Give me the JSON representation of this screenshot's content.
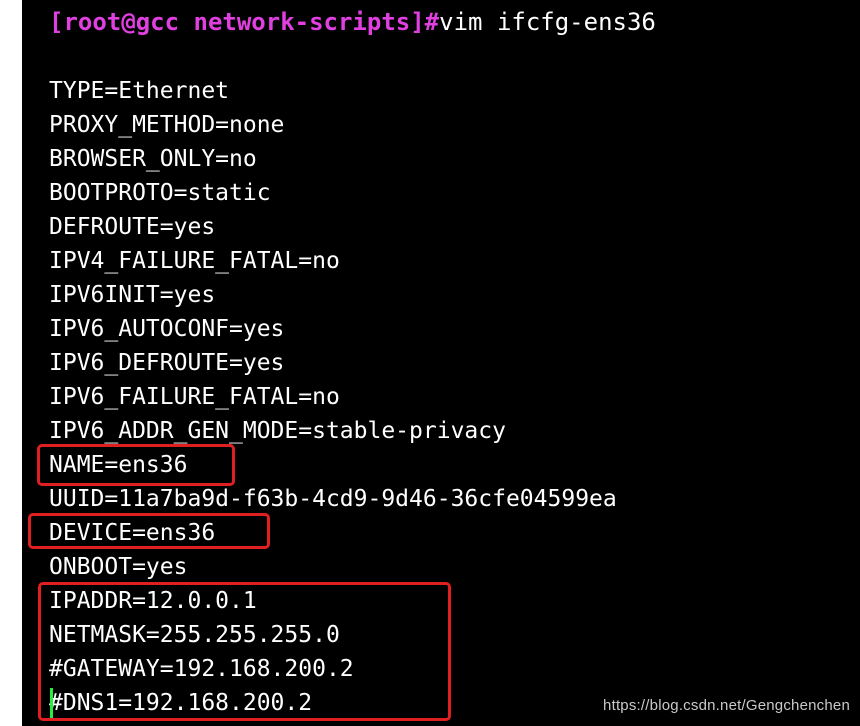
{
  "terminal": {
    "prompt": "[root@gcc network-scripts]#",
    "command": "vim ifcfg-ens36",
    "lines": [
      "TYPE=Ethernet",
      "PROXY_METHOD=none",
      "BROWSER_ONLY=no",
      "BOOTPROTO=static",
      "DEFROUTE=yes",
      "IPV4_FAILURE_FATAL=no",
      "IPV6INIT=yes",
      "IPV6_AUTOCONF=yes",
      "IPV6_DEFROUTE=yes",
      "IPV6_FAILURE_FATAL=no",
      "IPV6_ADDR_GEN_MODE=stable-privacy",
      "NAME=ens36",
      "UUID=11a7ba9d-f63b-4cd9-9d46-36cfe04599ea",
      "DEVICE=ens36",
      "ONBOOT=yes",
      "IPADDR=12.0.0.1",
      "NETMASK=255.255.255.0",
      "#GATEWAY=192.168.200.2",
      "#DNS1=192.168.200.2"
    ]
  },
  "watermark": "https://blog.csdn.net/Gengchenchen",
  "colors": {
    "background": "#000000",
    "text": "#ffffff",
    "prompt": "#e040e0",
    "highlight": "#e02020",
    "cursor": "#22ee44",
    "watermark": "#c9c9c9"
  }
}
